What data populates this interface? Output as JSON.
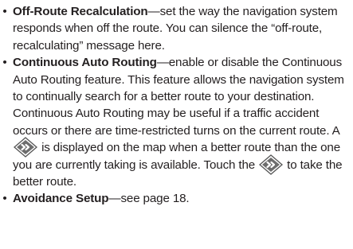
{
  "items": [
    {
      "bullet": "•",
      "term": "Off-Route Recalculation",
      "dash": "—",
      "text": "set the way the navigation system responds when off the route. You can silence the “off-route, recalculating” message here."
    },
    {
      "bullet": "•",
      "term": "Continuous Auto Routing",
      "dash": "—",
      "text_before_icon1": "enable or disable the Continuous Auto Routing feature. This feature allows the navigation system to continually search for a better route to your destination. Continuous Auto Routing may be useful if a traffic accident occurs or there are time-restricted turns on the current route. A ",
      "text_between_icons": " is displayed on the map when a better route than the one you are currently taking is available. Touch the ",
      "text_after_icon2": " to take the better route.",
      "icon": "better-route-sign-icon"
    },
    {
      "bullet": "•",
      "term": "Avoidance Setup",
      "dash": "—",
      "text": "see page 18."
    }
  ]
}
